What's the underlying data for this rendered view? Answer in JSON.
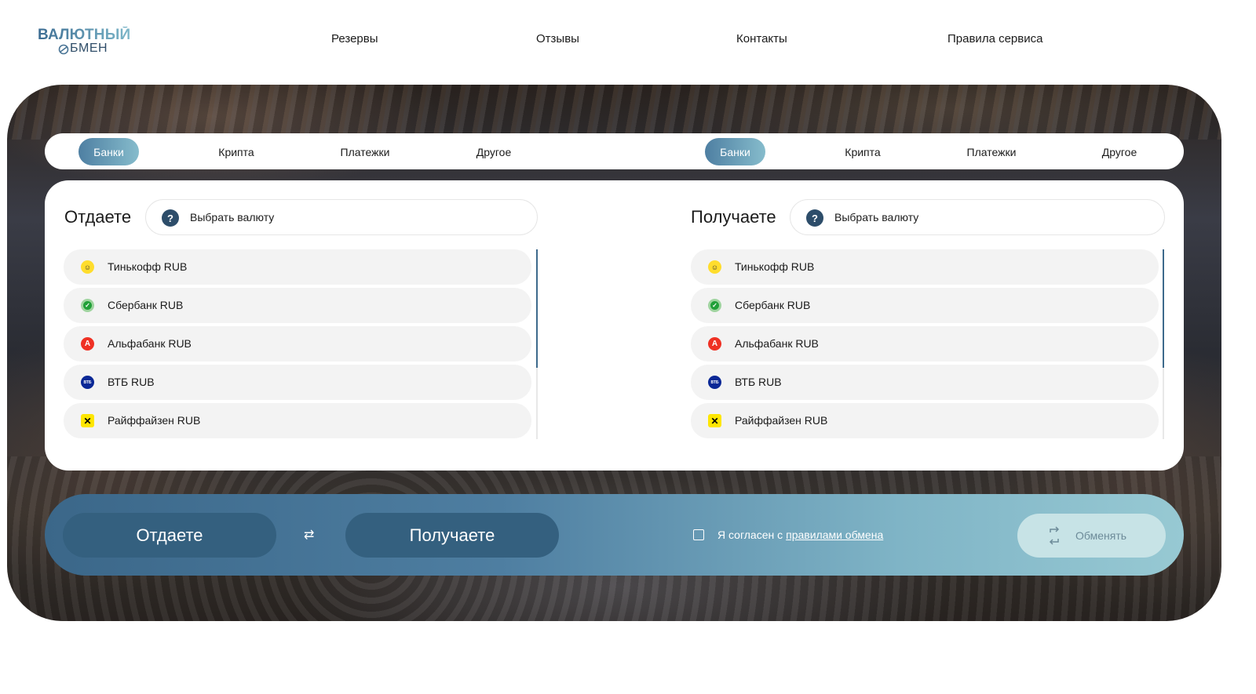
{
  "brand": {
    "line1": "ВАЛЮТНЫЙ",
    "line2": "БМЕН"
  },
  "nav": [
    "Резервы",
    "Отзывы",
    "Контакты",
    "Правила сервиса"
  ],
  "tabs_left": [
    {
      "label": "Банки",
      "active": true
    },
    {
      "label": "Крипта",
      "active": false
    },
    {
      "label": "Платежки",
      "active": false
    },
    {
      "label": "Другое",
      "active": false
    }
  ],
  "tabs_right": [
    {
      "label": "Банки",
      "active": true
    },
    {
      "label": "Крипта",
      "active": false
    },
    {
      "label": "Платежки",
      "active": false
    },
    {
      "label": "Другое",
      "active": false
    }
  ],
  "give": {
    "title": "Отдаете",
    "select_label": "Выбрать валюту",
    "items": [
      {
        "name": "Тинькофф RUB",
        "icon": "tinkoff-icon"
      },
      {
        "name": "Сбербанк RUB",
        "icon": "sberbank-icon"
      },
      {
        "name": "Альфабанк RUB",
        "icon": "alfabank-icon"
      },
      {
        "name": "ВТБ RUB",
        "icon": "vtb-icon"
      },
      {
        "name": "Райффайзен RUB",
        "icon": "raiffeisen-icon"
      }
    ]
  },
  "get": {
    "title": "Получаете",
    "select_label": "Выбрать валюту",
    "items": [
      {
        "name": "Тинькофф RUB",
        "icon": "tinkoff-icon"
      },
      {
        "name": "Сбербанк RUB",
        "icon": "sberbank-icon"
      },
      {
        "name": "Альфабанк RUB",
        "icon": "alfabank-icon"
      },
      {
        "name": "ВТБ RUB",
        "icon": "vtb-icon"
      },
      {
        "name": "Райффайзен RUB",
        "icon": "raiffeisen-icon"
      }
    ]
  },
  "bottom": {
    "give_label": "Отдаете",
    "get_label": "Получаете",
    "agree_text": "Я согласен с",
    "agree_link": "правилами обмена",
    "exchange_label": "Обменять"
  },
  "colors": {
    "accent_dark": "#34607f",
    "accent_gradient_start": "#4e7fa2",
    "accent_gradient_end": "#86bccc",
    "scroll": "#3e6a8c"
  }
}
